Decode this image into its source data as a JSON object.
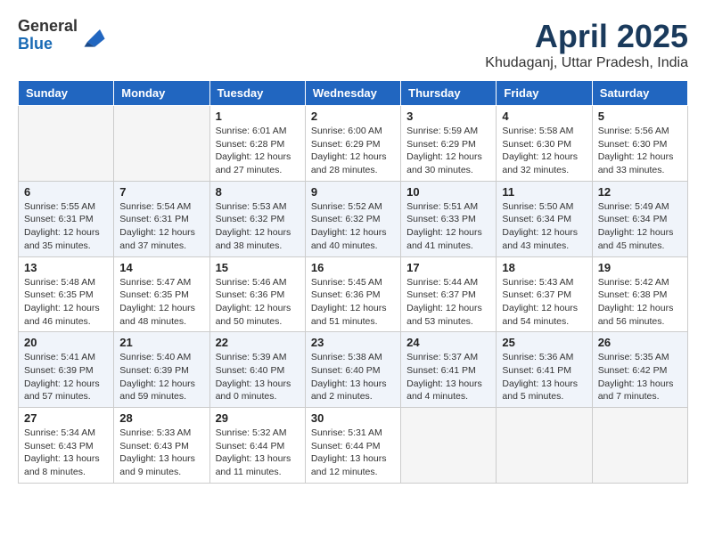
{
  "logo": {
    "general": "General",
    "blue": "Blue"
  },
  "title": "April 2025",
  "location": "Khudaganj, Uttar Pradesh, India",
  "days_of_week": [
    "Sunday",
    "Monday",
    "Tuesday",
    "Wednesday",
    "Thursday",
    "Friday",
    "Saturday"
  ],
  "weeks": [
    [
      {
        "day": "",
        "info": ""
      },
      {
        "day": "",
        "info": ""
      },
      {
        "day": "1",
        "info": "Sunrise: 6:01 AM\nSunset: 6:28 PM\nDaylight: 12 hours and 27 minutes."
      },
      {
        "day": "2",
        "info": "Sunrise: 6:00 AM\nSunset: 6:29 PM\nDaylight: 12 hours and 28 minutes."
      },
      {
        "day": "3",
        "info": "Sunrise: 5:59 AM\nSunset: 6:29 PM\nDaylight: 12 hours and 30 minutes."
      },
      {
        "day": "4",
        "info": "Sunrise: 5:58 AM\nSunset: 6:30 PM\nDaylight: 12 hours and 32 minutes."
      },
      {
        "day": "5",
        "info": "Sunrise: 5:56 AM\nSunset: 6:30 PM\nDaylight: 12 hours and 33 minutes."
      }
    ],
    [
      {
        "day": "6",
        "info": "Sunrise: 5:55 AM\nSunset: 6:31 PM\nDaylight: 12 hours and 35 minutes."
      },
      {
        "day": "7",
        "info": "Sunrise: 5:54 AM\nSunset: 6:31 PM\nDaylight: 12 hours and 37 minutes."
      },
      {
        "day": "8",
        "info": "Sunrise: 5:53 AM\nSunset: 6:32 PM\nDaylight: 12 hours and 38 minutes."
      },
      {
        "day": "9",
        "info": "Sunrise: 5:52 AM\nSunset: 6:32 PM\nDaylight: 12 hours and 40 minutes."
      },
      {
        "day": "10",
        "info": "Sunrise: 5:51 AM\nSunset: 6:33 PM\nDaylight: 12 hours and 41 minutes."
      },
      {
        "day": "11",
        "info": "Sunrise: 5:50 AM\nSunset: 6:34 PM\nDaylight: 12 hours and 43 minutes."
      },
      {
        "day": "12",
        "info": "Sunrise: 5:49 AM\nSunset: 6:34 PM\nDaylight: 12 hours and 45 minutes."
      }
    ],
    [
      {
        "day": "13",
        "info": "Sunrise: 5:48 AM\nSunset: 6:35 PM\nDaylight: 12 hours and 46 minutes."
      },
      {
        "day": "14",
        "info": "Sunrise: 5:47 AM\nSunset: 6:35 PM\nDaylight: 12 hours and 48 minutes."
      },
      {
        "day": "15",
        "info": "Sunrise: 5:46 AM\nSunset: 6:36 PM\nDaylight: 12 hours and 50 minutes."
      },
      {
        "day": "16",
        "info": "Sunrise: 5:45 AM\nSunset: 6:36 PM\nDaylight: 12 hours and 51 minutes."
      },
      {
        "day": "17",
        "info": "Sunrise: 5:44 AM\nSunset: 6:37 PM\nDaylight: 12 hours and 53 minutes."
      },
      {
        "day": "18",
        "info": "Sunrise: 5:43 AM\nSunset: 6:37 PM\nDaylight: 12 hours and 54 minutes."
      },
      {
        "day": "19",
        "info": "Sunrise: 5:42 AM\nSunset: 6:38 PM\nDaylight: 12 hours and 56 minutes."
      }
    ],
    [
      {
        "day": "20",
        "info": "Sunrise: 5:41 AM\nSunset: 6:39 PM\nDaylight: 12 hours and 57 minutes."
      },
      {
        "day": "21",
        "info": "Sunrise: 5:40 AM\nSunset: 6:39 PM\nDaylight: 12 hours and 59 minutes."
      },
      {
        "day": "22",
        "info": "Sunrise: 5:39 AM\nSunset: 6:40 PM\nDaylight: 13 hours and 0 minutes."
      },
      {
        "day": "23",
        "info": "Sunrise: 5:38 AM\nSunset: 6:40 PM\nDaylight: 13 hours and 2 minutes."
      },
      {
        "day": "24",
        "info": "Sunrise: 5:37 AM\nSunset: 6:41 PM\nDaylight: 13 hours and 4 minutes."
      },
      {
        "day": "25",
        "info": "Sunrise: 5:36 AM\nSunset: 6:41 PM\nDaylight: 13 hours and 5 minutes."
      },
      {
        "day": "26",
        "info": "Sunrise: 5:35 AM\nSunset: 6:42 PM\nDaylight: 13 hours and 7 minutes."
      }
    ],
    [
      {
        "day": "27",
        "info": "Sunrise: 5:34 AM\nSunset: 6:43 PM\nDaylight: 13 hours and 8 minutes."
      },
      {
        "day": "28",
        "info": "Sunrise: 5:33 AM\nSunset: 6:43 PM\nDaylight: 13 hours and 9 minutes."
      },
      {
        "day": "29",
        "info": "Sunrise: 5:32 AM\nSunset: 6:44 PM\nDaylight: 13 hours and 11 minutes."
      },
      {
        "day": "30",
        "info": "Sunrise: 5:31 AM\nSunset: 6:44 PM\nDaylight: 13 hours and 12 minutes."
      },
      {
        "day": "",
        "info": ""
      },
      {
        "day": "",
        "info": ""
      },
      {
        "day": "",
        "info": ""
      }
    ]
  ]
}
